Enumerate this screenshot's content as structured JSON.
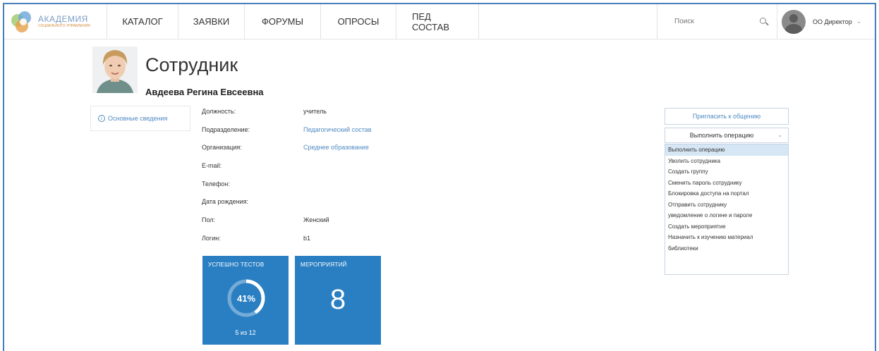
{
  "brand": {
    "title": "АКАДЕМИЯ",
    "subtitle": "СОЦИАЛЬНОГО УПРАВЛЕНИЯ"
  },
  "nav": {
    "items": [
      {
        "label": "КАТАЛОГ"
      },
      {
        "label": "ЗАЯВКИ"
      },
      {
        "label": "ФОРУМЫ"
      },
      {
        "label": "ОПРОСЫ"
      },
      {
        "label": "ПЕД СОСТАВ"
      }
    ]
  },
  "search": {
    "placeholder": "Поиск"
  },
  "user": {
    "name": "ОО Директор"
  },
  "page": {
    "title": "Сотрудник",
    "employee_name": "Авдеева Регина Евсеевна"
  },
  "side_nav": {
    "label": "Основные сведения"
  },
  "details": [
    {
      "label": "Должность:",
      "value": "учитель",
      "link": false
    },
    {
      "label": "Подразделение:",
      "value": "Педагогический состав",
      "link": true
    },
    {
      "label": "Организация:",
      "value": "Среднее образование",
      "link": true
    },
    {
      "label": "E-mail:",
      "value": "",
      "link": false
    },
    {
      "label": "Телефон:",
      "value": "",
      "link": false
    },
    {
      "label": "Дата рождения:",
      "value": "",
      "link": false
    },
    {
      "label": "Пол:",
      "value": "Женский",
      "link": false
    },
    {
      "label": "Логин:",
      "value": "b1",
      "link": false
    }
  ],
  "tiles": {
    "tests": {
      "label": "УСПЕШНО ТЕСТОВ",
      "percent_text": "41%",
      "percent": 41,
      "sub": "5 из 12",
      "color": "#2a7fc2"
    },
    "events": {
      "label": "МЕРОПРИЯТИЙ",
      "value": "8",
      "color": "#2a7fc2"
    }
  },
  "actions": {
    "invite_label": "Пригласить к общению",
    "operations_selected": "Выполнить операцию",
    "operations": [
      "Выполнить операцию",
      "Уволить сотрудника",
      "Создать группу",
      "Сменить пароль сотруднику",
      "Блокировка доступа на портал",
      "Отправить сотруднику",
      "уведомление о логине и пароле",
      "Создать мероприятие",
      "Назначить к изучению материал",
      "библиотеки"
    ]
  },
  "colors": {
    "accent": "#2a7fc2",
    "link": "#4f8ac2",
    "frame": "#4a7ebb"
  }
}
